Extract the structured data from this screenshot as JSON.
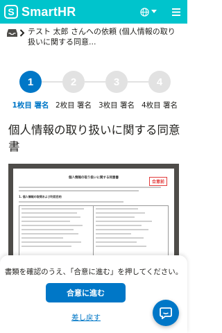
{
  "header": {
    "logo_mark": "S",
    "logo_text": "SmartHR",
    "brand_color": "#00c4cc"
  },
  "breadcrumb": {
    "icons": [
      "inbox-icon",
      "chevron-right-icon"
    ],
    "text": "テスト 太郎 さんへの依頼 (個人情報の取り扱いに関する同意..."
  },
  "stepper": {
    "steps": [
      {
        "number": "1",
        "label": "1枚目 署名",
        "active": true
      },
      {
        "number": "2",
        "label": "2枚目 署名",
        "active": false
      },
      {
        "number": "3",
        "label": "3枚目 署名",
        "active": false
      },
      {
        "number": "4",
        "label": "4枚目 署名",
        "active": false
      }
    ],
    "active_color": "#0077c7",
    "inactive_color": "#e2e2e2"
  },
  "document": {
    "title": "個人情報の取り扱いに関する同意書",
    "preview_heading": "個人情報の取り扱いに関する同意書",
    "preview_stamp": "合意前",
    "preview_section": "1. 個人情報の取得および利用目的"
  },
  "sheet": {
    "message": "書類を確認のうえ、「合意に進む」を押してください。",
    "agree_label": "合意に進む",
    "return_label": "差し戻す"
  }
}
